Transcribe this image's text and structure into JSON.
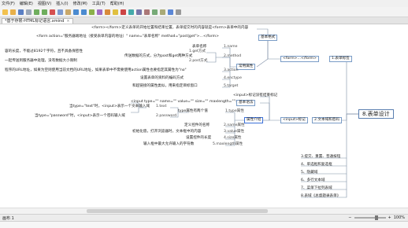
{
  "menu": [
    "文件(F)",
    "编辑(E)",
    "视图(V)",
    "插入(I)",
    "修改(M)",
    "工具(T)",
    "帮助(H)"
  ],
  "tab": {
    "label": "*基于存限-HTML标记语言.xmind"
  },
  "root": "8.表单设计",
  "branches": {
    "tag": "1.表单标签",
    "tag_form": "<form>…</form>",
    "tag_common": "常用属性",
    "tag_desc": "<form></form>定义表单的开始位置和结束位置，表单提交时的内容就是<form>表单中的内容",
    "tag_syntax_code": "<form action=\"服务器端地址（接受表单内容的地址）\" name=\"表单名称\" method=\"post|get\">…</form>",
    "tag_syntax": "基本格式",
    "attr_name_desc": "表单名称",
    "attr_name": "1.name",
    "attr_method_desc": "传送数据的方式，分为post和get两种方式",
    "attr_method": "2.method",
    "get_desc": "容的长度，不能过8192个字符，且不具备保密性",
    "get": "1.get方式",
    "post_desc": "一起传送到服务器中处理，没有数据大小限制",
    "post": "2.post方式",
    "action_desc": "程序的URL地址，如果为空则使用当前文档的URL地址，如果表单中不需要使用action属性也要指定其属性为\"no\"",
    "action": "3.action",
    "enctype_desc": "设置表单的资料的编码方式",
    "enctype": "4.enctype",
    "target_desc": "和超链接的属性类似，用来指定目标窗口",
    "target": "5.target",
    "input": "2.文本域和密码",
    "input_tag": "<input>标记",
    "input_label": "<input>标记没有结束标记",
    "input_syntax_code": "<input type=\"\" name=\"\" value=\"\" size=\"\" maxlength=\"\">",
    "input_syntax": "基本语法",
    "type_group": "type属性有两个值",
    "type_text_desc": "当type=\"text\"时，<input>表示一个文本输入域",
    "type_text": "1.text",
    "type_pass_desc": "当type=\"password\"时，<input>表示一个密码输入域",
    "type_pass": "2.password",
    "type_attr": "1.type属性",
    "attr_group": "属性介绍",
    "i_name_desc": "定义控件的名称",
    "i_name": "2.name属性",
    "i_value_desc": "初始化值，打开浏览器时，文本框中的内容",
    "i_value": "3.value属性",
    "i_size_desc": "设置控件的长度",
    "i_size": "4.size属性",
    "i_max_desc": "输入框中最大允许输入的字符数",
    "i_max": "5.maxlength属性",
    "b3": "3.提交、重置、普通按钮",
    "b4": "4、单选框和复选框",
    "b5": "5、隐藏域",
    "b6": "6、多行文本域",
    "b7": "7、菜单下拉列表域",
    "b8": "8.表域《总督题录表单》"
  },
  "status": {
    "sheet": "画布 1",
    "zoom": "100%"
  }
}
